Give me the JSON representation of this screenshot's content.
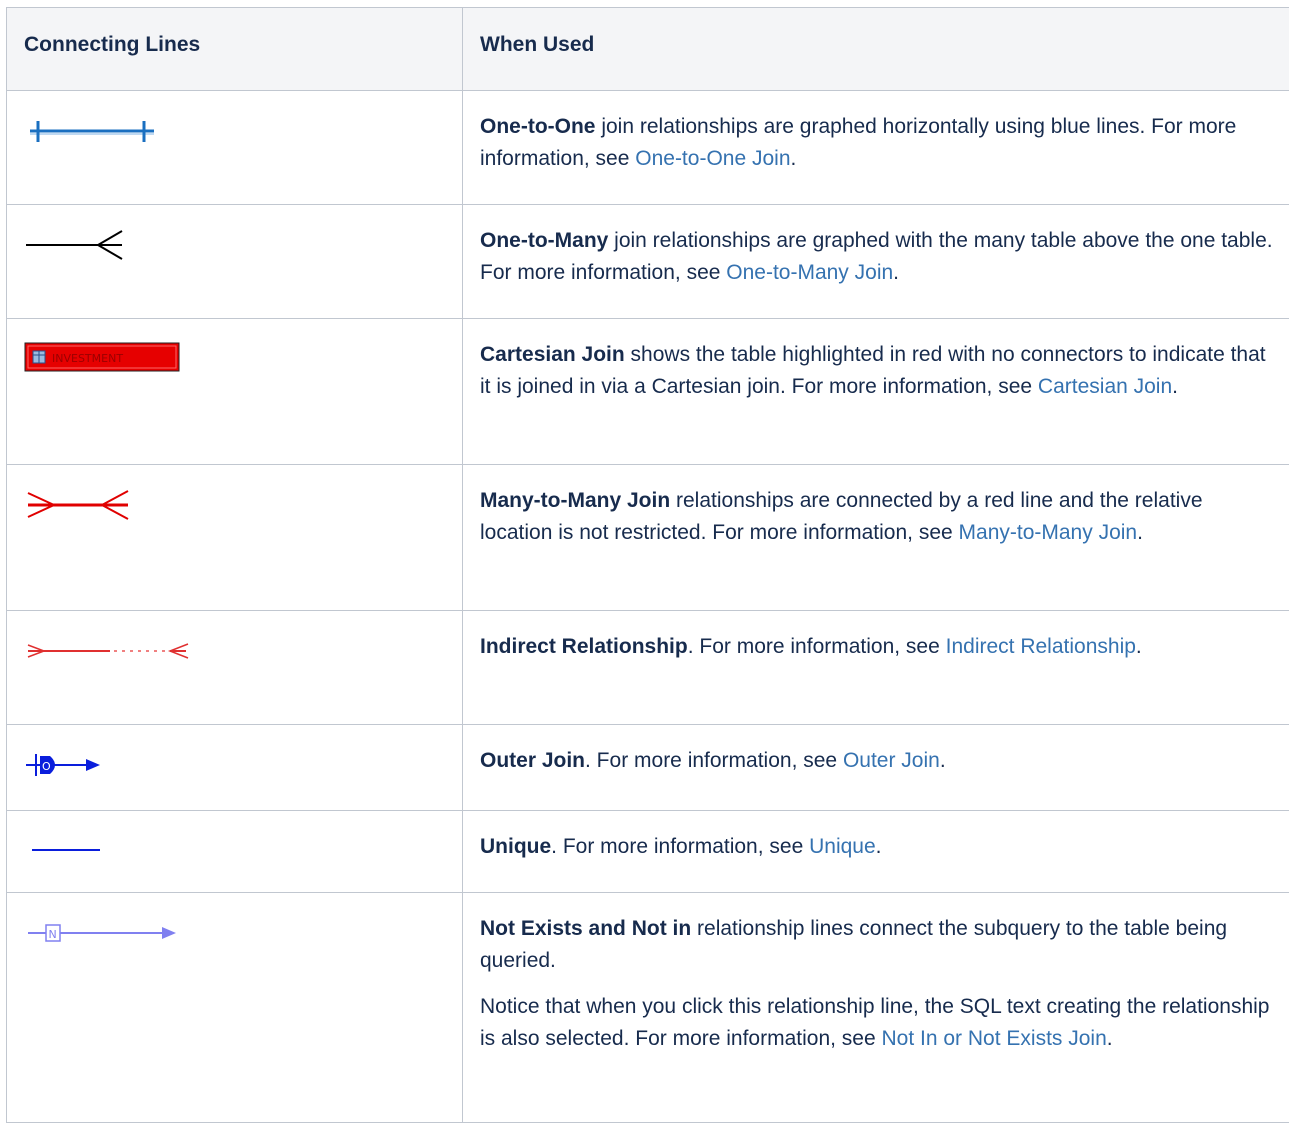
{
  "headers": {
    "col1": "Connecting Lines",
    "col2": "When Used"
  },
  "rows": [
    {
      "icon": "one-to-one-line-icon",
      "bold": "One-to-One",
      "text": " join relationships are graphed horizontally using blue lines. For more information, see ",
      "link": "One-to-One Join",
      "end": "."
    },
    {
      "icon": "one-to-many-line-icon",
      "bold": "One-to-Many",
      "text": " join relationships are graphed with the many table above the one table. For more information, see ",
      "link": "One-to-Many Join",
      "end": "."
    },
    {
      "icon": "cartesian-table-icon",
      "icon_label": "INVESTMENT",
      "bold": "Cartesian Join",
      "text": " shows the table highlighted in red with no connectors to indicate that it is joined in via a Cartesian join. For more information, see ",
      "link": "Cartesian Join",
      "end": "."
    },
    {
      "icon": "many-to-many-line-icon",
      "bold": "Many-to-Many Join",
      "text": " relationships are connected by a red line and the relative location is not restricted. For more information, see ",
      "link": "Many-to-Many Join",
      "end": "."
    },
    {
      "icon": "indirect-relationship-line-icon",
      "bold": "Indirect Relationship",
      "text": ". For more information, see ",
      "link": "Indirect Relationship",
      "end": "."
    },
    {
      "icon": "outer-join-line-icon",
      "icon_label": "O",
      "bold": "Outer Join",
      "text": ". For more information, see ",
      "link": "Outer Join",
      "end": "."
    },
    {
      "icon": "unique-line-icon",
      "bold": "Unique",
      "text": ". For more information, see ",
      "link": "Unique",
      "end": "."
    },
    {
      "icon": "not-exists-line-icon",
      "icon_label": "N",
      "bold": "Not Exists and Not in",
      "text": " relationship lines connect the subquery to the table being queried.",
      "para2_text": "Notice that when you click this relationship line, the SQL text creating the relationship is also selected. For more information, see ",
      "link": "Not In or Not Exists Join",
      "end": "."
    }
  ],
  "colors": {
    "link": "#3572b0",
    "border": "#c1c7d0",
    "header_bg": "#f4f5f7",
    "text": "#172b4d"
  }
}
